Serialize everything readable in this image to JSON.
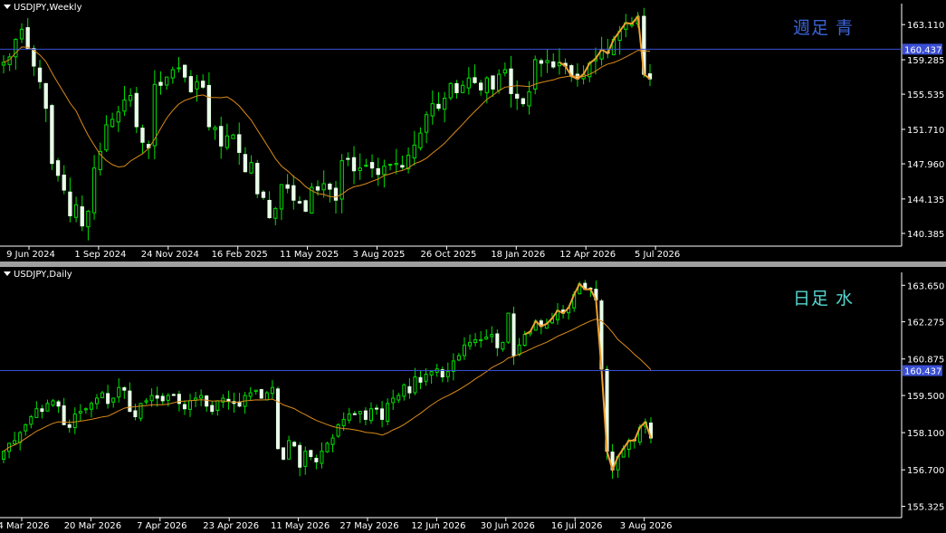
{
  "chart_data": [
    {
      "type": "candlestick",
      "symbol_label": "USDJPY,Weekly",
      "annotation": "週足  青",
      "annotation_color": "#3b64d6",
      "ylim": [
        139.0,
        165.0
      ],
      "y_ticks": [
        "163.110",
        "159.285",
        "155.535",
        "151.710",
        "147.960",
        "144.135",
        "140.385"
      ],
      "y_tick_values": [
        163.11,
        159.285,
        155.535,
        151.71,
        147.96,
        144.135,
        140.385
      ],
      "x_ticks": [
        "9 Jun 2024",
        "1 Sep 2024",
        "24 Nov 2024",
        "16 Feb 2025",
        "11 May 2025",
        "3 Aug 2025",
        "26 Oct 2025",
        "18 Jan 2026",
        "12 Apr 2026",
        "5 Jul 2026"
      ],
      "hline": {
        "value": 160.437,
        "label": "160.437",
        "color": "#3a4fd4"
      },
      "closes": [
        159.0,
        159.6,
        161.5,
        162.6,
        160.5,
        158.6,
        156.9,
        154.0,
        148.0,
        146.7,
        145.1,
        142.3,
        143.5,
        141.2,
        142.8,
        147.5,
        149.3,
        152.2,
        152.8,
        153.6,
        154.9,
        155.4,
        152.0,
        150.3,
        149.7,
        156.6,
        156.5,
        157.4,
        158.2,
        158.4,
        157.4,
        155.8,
        156.9,
        156.3,
        152.0,
        151.9,
        149.9,
        151.0,
        151.1,
        149.2,
        147.1,
        148.1,
        144.7,
        144.3,
        142.1,
        143.1,
        145.7,
        145.3,
        144.0,
        143.7,
        142.8,
        145.4,
        145.1,
        145.8,
        145.2,
        144.0,
        148.3,
        148.5,
        147.2,
        147.5,
        147.8,
        147.5,
        146.8,
        147.7,
        147.9,
        148.0,
        147.6,
        148.9,
        150.0,
        151.3,
        153.3,
        154.5,
        154.0,
        155.1,
        156.7,
        155.7,
        156.5,
        157.3,
        156.8,
        156.0,
        157.3,
        156.1,
        157.7,
        158.2,
        155.6,
        155.1,
        154.5,
        155.8,
        159.3,
        158.9,
        159.2,
        158.5,
        159.0,
        158.6,
        157.5,
        157.2,
        157.7,
        158.9,
        159.4,
        160.4,
        160.0,
        161.5,
        162.4,
        163.3,
        163.2,
        164.0,
        157.7,
        157.2
      ],
      "ma_ylabel": "",
      "overlay_color": "#f0a030",
      "ma_color": "#d98a1a"
    },
    {
      "type": "candlestick",
      "symbol_label": "USDJPY,Daily",
      "annotation": "日足  水",
      "annotation_color": "#55d8d0",
      "ylim": [
        154.9,
        164.0
      ],
      "y_ticks": [
        "163.650",
        "162.275",
        "160.875",
        "159.500",
        "158.100",
        "156.700",
        "155.325"
      ],
      "y_tick_values": [
        163.65,
        162.275,
        160.875,
        159.5,
        158.1,
        156.7,
        155.325
      ],
      "x_ticks": [
        "4 Mar 2026",
        "20 Mar 2026",
        "7 Apr 2026",
        "23 Apr 2026",
        "11 May 2026",
        "27 May 2026",
        "12 Jun 2026",
        "30 Jun 2026",
        "16 Jul 2026",
        "3 Aug 2026"
      ],
      "hline": {
        "value": 160.437,
        "label": "160.437",
        "color": "#3a4fd4"
      },
      "closes": [
        157.4,
        157.7,
        157.8,
        158.1,
        158.4,
        158.7,
        159.0,
        158.9,
        159.2,
        159.3,
        159.1,
        158.4,
        158.3,
        158.8,
        158.9,
        159.0,
        159.2,
        159.4,
        159.6,
        159.2,
        159.4,
        159.8,
        159.7,
        158.9,
        158.7,
        159.2,
        159.3,
        159.5,
        159.4,
        159.3,
        159.5,
        159.5,
        159.2,
        159.0,
        159.3,
        159.4,
        159.5,
        159.1,
        158.9,
        159.3,
        159.4,
        159.3,
        159.2,
        159.1,
        159.5,
        159.6,
        159.7,
        159.4,
        159.6,
        159.8,
        157.5,
        157.1,
        157.8,
        157.6,
        156.8,
        157.4,
        157.2,
        157.0,
        157.4,
        157.7,
        157.9,
        158.4,
        158.6,
        158.8,
        158.8,
        158.9,
        158.6,
        159.0,
        159.0,
        158.6,
        159.2,
        159.4,
        159.5,
        159.9,
        159.6,
        160.2,
        160.0,
        160.3,
        160.4,
        160.5,
        160.2,
        160.4,
        160.8,
        161.0,
        161.4,
        161.5,
        161.6,
        161.6,
        161.7,
        161.8,
        161.3,
        161.5,
        162.6,
        161.0,
        161.4,
        161.8,
        161.9,
        162.3,
        162.1,
        162.2,
        162.4,
        162.7,
        162.6,
        162.8,
        163.3,
        163.7,
        163.5,
        163.5,
        163.1,
        160.5,
        157.4,
        156.7,
        157.2,
        157.5,
        157.8,
        157.8,
        158.3,
        158.5,
        157.9
      ],
      "overlay_color": "#f0a030",
      "ma_color": "#d98a1a"
    }
  ]
}
